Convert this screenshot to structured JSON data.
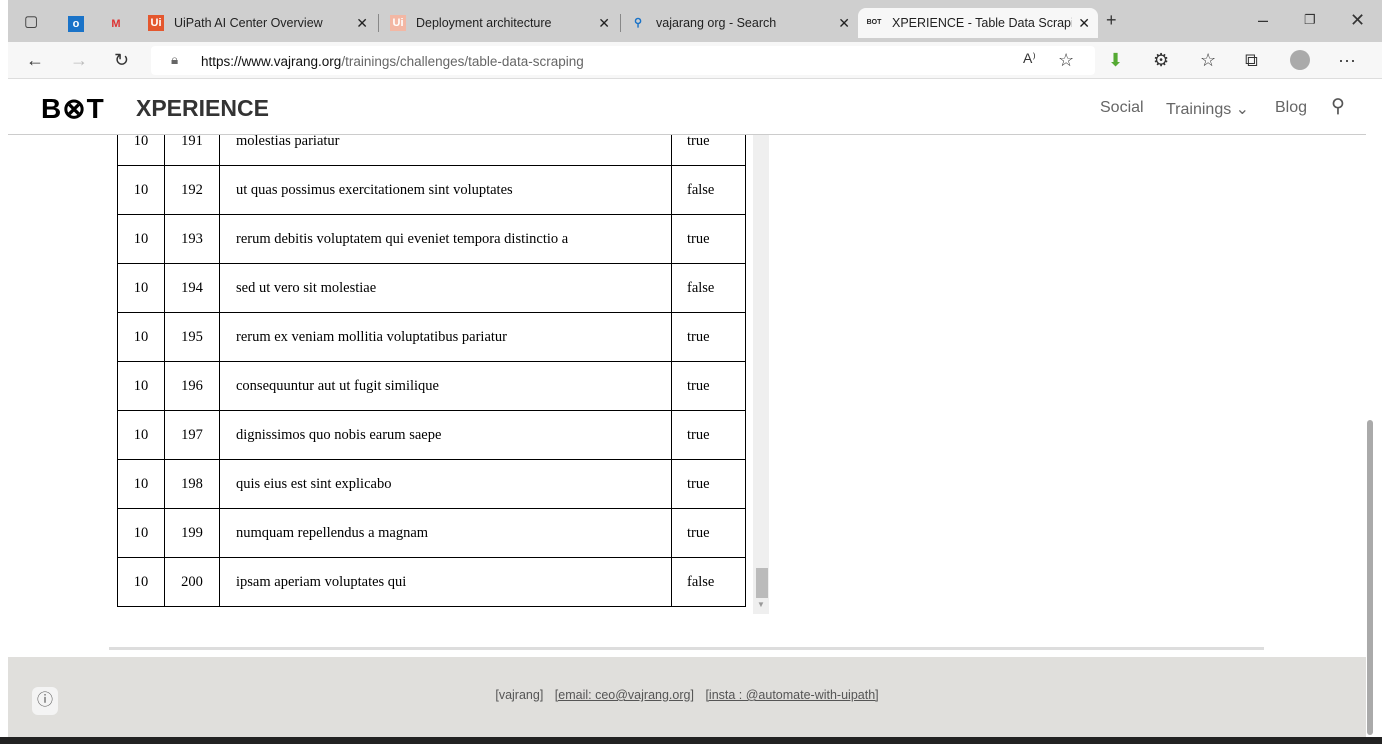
{
  "tabs": [
    {
      "label": "UiPath AI Center Overview"
    },
    {
      "label": "Deployment architecture"
    },
    {
      "label": "vajarang org - Search"
    },
    {
      "label": "XPERIENCE - Table Data Scraping"
    }
  ],
  "url": {
    "domain": "https://www.vajrang.org",
    "path": "/trainings/challenges/table-data-scraping"
  },
  "site": {
    "logo": "B⊗T",
    "brand": "XPERIENCE",
    "nav": [
      "Social",
      "Trainings",
      "Blog"
    ]
  },
  "rows": [
    [
      "10",
      "191",
      "molestias pariatur",
      "true"
    ],
    [
      "10",
      "192",
      "ut quas possimus exercitationem sint voluptates",
      "false"
    ],
    [
      "10",
      "193",
      "rerum debitis voluptatem qui eveniet tempora distinctio a",
      "true"
    ],
    [
      "10",
      "194",
      "sed ut vero sit molestiae",
      "false"
    ],
    [
      "10",
      "195",
      "rerum ex veniam mollitia voluptatibus pariatur",
      "true"
    ],
    [
      "10",
      "196",
      "consequuntur aut ut fugit similique",
      "true"
    ],
    [
      "10",
      "197",
      "dignissimos quo nobis earum saepe",
      "true"
    ],
    [
      "10",
      "198",
      "quis eius est sint explicabo",
      "true"
    ],
    [
      "10",
      "199",
      "numquam repellendus a magnam",
      "true"
    ],
    [
      "10",
      "200",
      "ipsam aperiam voluptates qui",
      "false"
    ]
  ],
  "footer": {
    "name": "[vajrang]",
    "email": "[email: ceo@vajrang.org]",
    "insta": "[insta : @automate-with-uipath]"
  }
}
